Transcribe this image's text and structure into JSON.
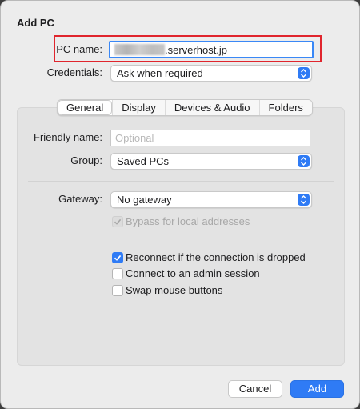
{
  "dialog": {
    "title": "Add PC",
    "pc_name": {
      "label": "PC name:",
      "value_suffix": ".serverhost.jp"
    },
    "credentials": {
      "label": "Credentials:",
      "value": "Ask when required"
    },
    "tabs": [
      "General",
      "Display",
      "Devices & Audio",
      "Folders"
    ],
    "general": {
      "friendly_name": {
        "label": "Friendly name:",
        "placeholder": "Optional"
      },
      "group": {
        "label": "Group:",
        "value": "Saved PCs"
      },
      "gateway": {
        "label": "Gateway:",
        "value": "No gateway"
      },
      "bypass": {
        "label": "Bypass for local addresses",
        "checked": true,
        "enabled": false
      },
      "options": [
        {
          "label": "Reconnect if the connection is dropped",
          "checked": true
        },
        {
          "label": "Connect to an admin session",
          "checked": false
        },
        {
          "label": "Swap mouse buttons",
          "checked": false
        }
      ]
    },
    "buttons": {
      "cancel": "Cancel",
      "add": "Add"
    }
  },
  "colors": {
    "accent": "#2f7bf5",
    "highlight": "#e0252d"
  }
}
